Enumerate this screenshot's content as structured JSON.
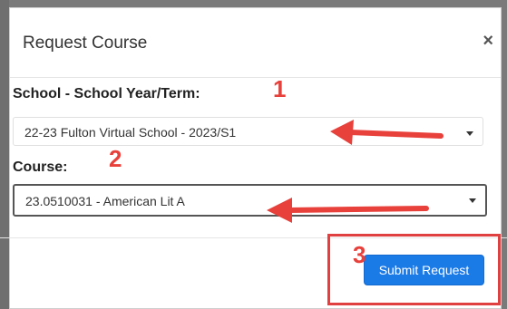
{
  "modal": {
    "title": "Request Course",
    "close_symbol": "×"
  },
  "form": {
    "school_label": "School - School Year/Term:",
    "school_value": "22-23 Fulton Virtual School - 2023/S1",
    "course_label": "Course:",
    "course_value": "23.0510031 - American Lit A"
  },
  "footer": {
    "submit_label": "Submit Request"
  },
  "annotations": {
    "step_1": "1",
    "step_2": "2",
    "step_3": "3",
    "color": "#e8403a"
  },
  "icons": {
    "close": "close-icon",
    "dropdown": "chevron-down-icon"
  },
  "colors": {
    "primary_button": "#1a7ae6",
    "annotation_red": "#e8403a"
  }
}
